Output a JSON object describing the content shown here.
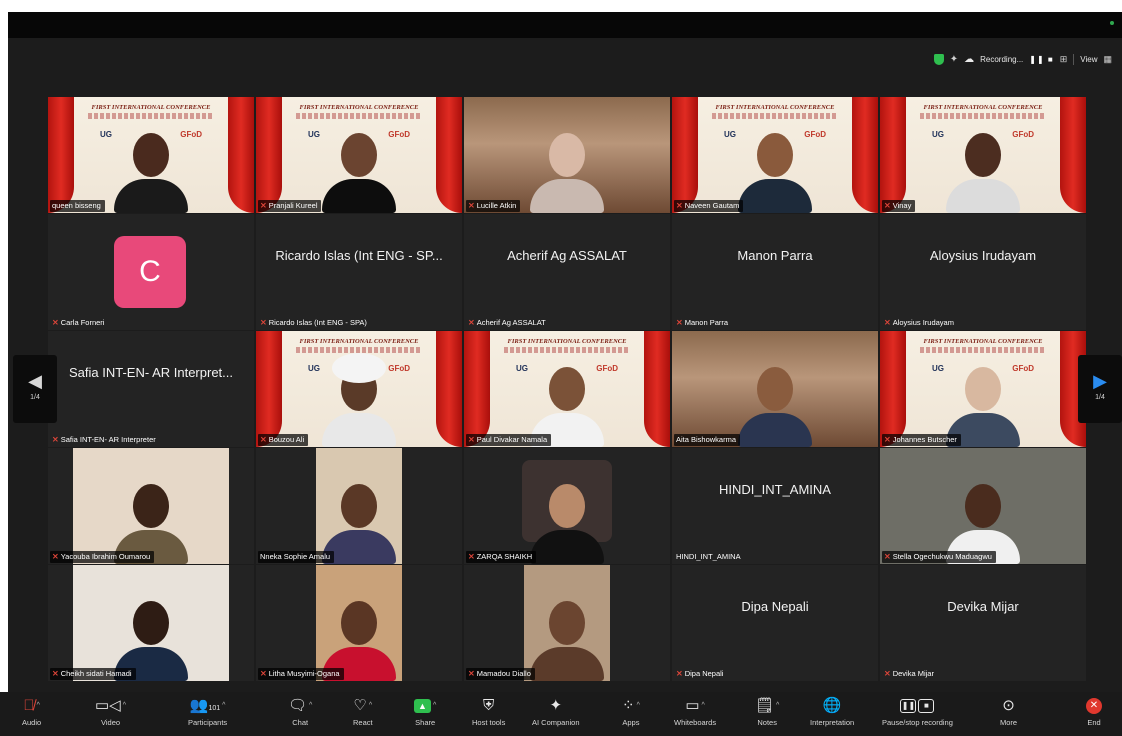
{
  "status": {
    "recording_label": "Recording...",
    "view_label": "View"
  },
  "participants": [
    {
      "name": "queen bisseng",
      "display": "",
      "muted": false
    },
    {
      "name": "Pranjali Kureel",
      "display": "",
      "muted": true
    },
    {
      "name": "Lucille Atkin",
      "display": "",
      "muted": true
    },
    {
      "name": "Naveen Gautam",
      "display": "",
      "muted": true
    },
    {
      "name": "Vinay",
      "display": "",
      "muted": true
    },
    {
      "name": "Carla Forneri",
      "display": "C",
      "muted": true
    },
    {
      "name": "Ricardo Islas (Int ENG - SPA)",
      "display": "Ricardo Islas (Int ENG - SP...",
      "muted": true
    },
    {
      "name": "Acherif Ag ASSALAT",
      "display": "Acherif Ag ASSALAT",
      "muted": true
    },
    {
      "name": "Manon Parra",
      "display": "Manon Parra",
      "muted": true
    },
    {
      "name": "Aloysius Irudayam",
      "display": "Aloysius Irudayam",
      "muted": true
    },
    {
      "name": "Safia INT-EN- AR Interpreter",
      "display": "Safia INT-EN- AR Interpret...",
      "muted": true
    },
    {
      "name": "Bouzou Ali",
      "display": "",
      "muted": true
    },
    {
      "name": "Paul Divakar Namala",
      "display": "",
      "muted": true
    },
    {
      "name": "Aita Bishowkarma",
      "display": "",
      "muted": false
    },
    {
      "name": "Johannes Butscher",
      "display": "",
      "muted": true
    },
    {
      "name": "Yacouba Ibrahim Oumarou",
      "display": "",
      "muted": true
    },
    {
      "name": "Nneka Sophie Amalu",
      "display": "",
      "muted": false
    },
    {
      "name": "ZARQA SHAIKH",
      "display": "",
      "muted": true
    },
    {
      "name": "HINDI_INT_AMINA",
      "display": "HINDI_INT_AMINA",
      "muted": false
    },
    {
      "name": "Stella Ogechukwu Maduagwu",
      "display": "",
      "muted": true
    },
    {
      "name": "Cheikh sidati Hamadi",
      "display": "",
      "muted": true
    },
    {
      "name": "Litha Musyimi-Ogana",
      "display": "",
      "muted": true
    },
    {
      "name": "Mamadou Diallo",
      "display": "",
      "muted": true
    },
    {
      "name": "Dipa Nepali",
      "display": "Dipa Nepali",
      "muted": true
    },
    {
      "name": "Devika Mijar",
      "display": "Devika Mijar",
      "muted": true
    }
  ],
  "banner": {
    "title": "FIRST INTERNATIONAL CONFERENCE",
    "logo_text": "UG",
    "org_text": "GFoD"
  },
  "pagination": {
    "left": "1/4",
    "right": "1/4"
  },
  "toolbar": {
    "audio": "Audio",
    "video": "Video",
    "participants": "Participants",
    "participants_count": "101",
    "chat": "Chat",
    "react": "React",
    "share": "Share",
    "host_tools": "Host tools",
    "ai_companion": "AI Companion",
    "apps": "Apps",
    "whiteboards": "Whiteboards",
    "notes": "Notes",
    "interpretation": "Interpretation",
    "pause_recording": "Pause/stop recording",
    "more": "More",
    "end": "End"
  }
}
